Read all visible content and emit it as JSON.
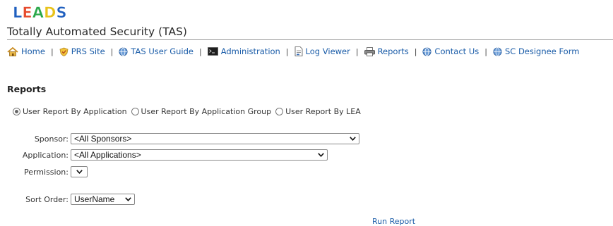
{
  "logo": {
    "text": "LEADS",
    "letters": [
      "L",
      "E",
      "A",
      "D",
      "S"
    ],
    "colors": [
      "#1f5fbf",
      "#e64b2e",
      "#2aa84a",
      "#e8c21a",
      "#1f5fbf"
    ]
  },
  "app_title": "Totally Automated Security (TAS)",
  "nav": [
    {
      "label": "Home",
      "icon": "home-icon"
    },
    {
      "label": "PRS Site",
      "icon": "shield-icon"
    },
    {
      "label": "TAS User Guide",
      "icon": "globe-icon"
    },
    {
      "label": "Administration",
      "icon": "terminal-icon"
    },
    {
      "label": "Log Viewer",
      "icon": "document-icon"
    },
    {
      "label": "Reports",
      "icon": "printer-icon"
    },
    {
      "label": "Contact Us",
      "icon": "globe-icon"
    },
    {
      "label": "SC Designee Form",
      "icon": "globe-icon"
    }
  ],
  "nav_separator": "|",
  "section_heading": "Reports",
  "report_types": [
    {
      "label": "User Report By Application",
      "selected": true
    },
    {
      "label": "User Report By Application Group",
      "selected": false
    },
    {
      "label": "User Report By LEA",
      "selected": false
    }
  ],
  "filters": {
    "sponsor": {
      "label": "Sponsor:",
      "value": "<All Sponsors>"
    },
    "application": {
      "label": "Application:",
      "value": "<All Applications>"
    },
    "permission": {
      "label": "Permission:",
      "value": ""
    },
    "sort_order": {
      "label": "Sort Order:",
      "value": "UserName"
    }
  },
  "run_report_label": "Run Report",
  "colors": {
    "link": "#1a5ca8",
    "rule": "#9a9a9a"
  }
}
